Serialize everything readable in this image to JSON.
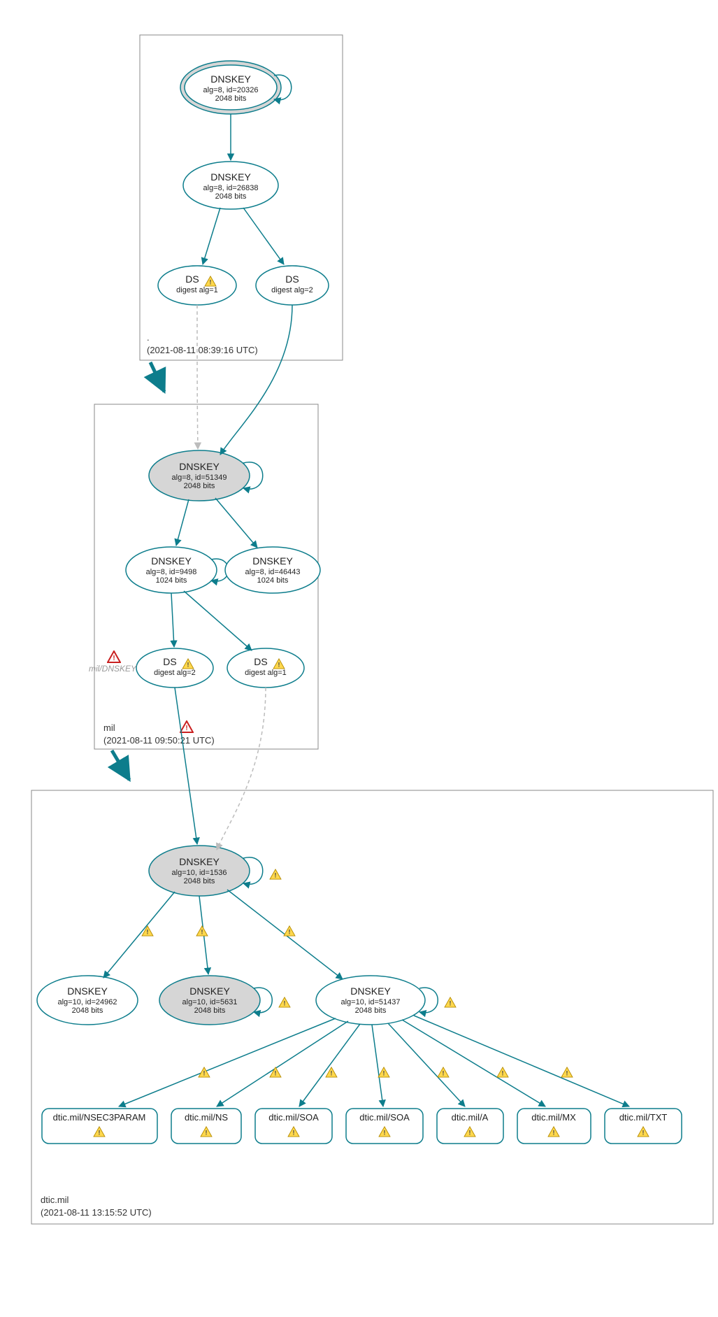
{
  "zones": {
    "root": {
      "label": ".",
      "timestamp": "(2021-08-11 08:39:16 UTC)",
      "nodes": {
        "ksk": {
          "title": "DNSKEY",
          "sub1": "alg=8, id=20326",
          "sub2": "2048 bits"
        },
        "zsk": {
          "title": "DNSKEY",
          "sub1": "alg=8, id=26838",
          "sub2": "2048 bits"
        },
        "ds1": {
          "title": "DS",
          "sub1": "digest alg=1",
          "warn": true
        },
        "ds2": {
          "title": "DS",
          "sub1": "digest alg=2"
        }
      }
    },
    "mil": {
      "label": "mil",
      "timestamp": "(2021-08-11 09:50:21 UTC)",
      "side_label": "mil/DNSKEY",
      "nodes": {
        "ksk": {
          "title": "DNSKEY",
          "sub1": "alg=8, id=51349",
          "sub2": "2048 bits"
        },
        "zsk1": {
          "title": "DNSKEY",
          "sub1": "alg=8, id=9498",
          "sub2": "1024 bits"
        },
        "zsk2": {
          "title": "DNSKEY",
          "sub1": "alg=8, id=46443",
          "sub2": "1024 bits"
        },
        "ds1": {
          "title": "DS",
          "sub1": "digest alg=2",
          "warn": true
        },
        "ds2": {
          "title": "DS",
          "sub1": "digest alg=1",
          "warn": true
        }
      }
    },
    "dtic": {
      "label": "dtic.mil",
      "timestamp": "(2021-08-11 13:15:52 UTC)",
      "nodes": {
        "ksk": {
          "title": "DNSKEY",
          "sub1": "alg=10, id=1536",
          "sub2": "2048 bits"
        },
        "k2": {
          "title": "DNSKEY",
          "sub1": "alg=10, id=24962",
          "sub2": "2048 bits"
        },
        "k3": {
          "title": "DNSKEY",
          "sub1": "alg=10, id=5631",
          "sub2": "2048 bits"
        },
        "k4": {
          "title": "DNSKEY",
          "sub1": "alg=10, id=51437",
          "sub2": "2048 bits"
        }
      },
      "rr": [
        {
          "label": "dtic.mil/NSEC3PARAM"
        },
        {
          "label": "dtic.mil/NS"
        },
        {
          "label": "dtic.mil/SOA"
        },
        {
          "label": "dtic.mil/SOA"
        },
        {
          "label": "dtic.mil/A"
        },
        {
          "label": "dtic.mil/MX"
        },
        {
          "label": "dtic.mil/TXT"
        }
      ]
    }
  }
}
